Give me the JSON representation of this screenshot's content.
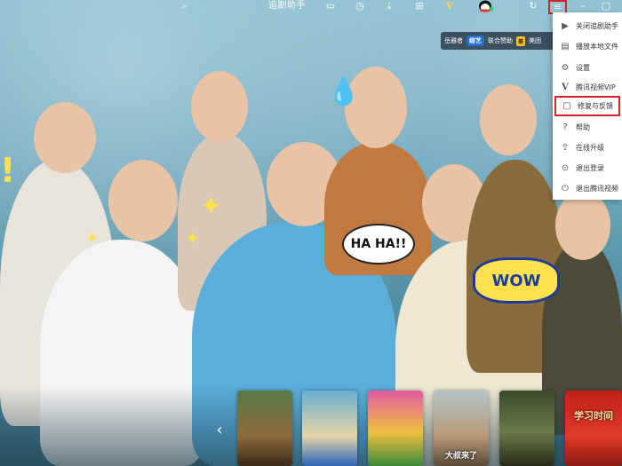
{
  "topbar": {
    "search_icon": "search-icon",
    "assistant_label": "追剧助手",
    "icons": [
      "play-screen-icon",
      "history-icon",
      "download-icon",
      "game-controller-icon",
      "vip-icon",
      "qq-avatar-icon",
      "refresh-icon",
      "menu-icon",
      "minimize-icon",
      "maximize-icon"
    ],
    "vip_glyph": "V"
  },
  "promo": {
    "text1": "岳雅者",
    "badge1": "综艺",
    "text2": "联合赞助",
    "badge2": "美",
    "text3": "美团"
  },
  "menu": {
    "items": [
      {
        "label": "关闭追剧助手",
        "icon": "play-circle-icon"
      },
      {
        "label": "播放本地文件",
        "icon": "folder-icon"
      },
      {
        "label": "设置",
        "icon": "gear-icon"
      },
      {
        "label": "腾讯视频VIP",
        "icon": "vip-v-icon"
      },
      {
        "label": "修复与反馈",
        "icon": "feedback-icon"
      },
      {
        "label": "帮助",
        "icon": "help-icon"
      },
      {
        "label": "在线升级",
        "icon": "upgrade-icon"
      },
      {
        "label": "退出登录",
        "icon": "logout-icon"
      },
      {
        "label": "退出腾讯视频",
        "icon": "power-icon"
      }
    ]
  },
  "stickers": {
    "haha": "HA HA!!",
    "wow": "WOW"
  },
  "thumbnails": [
    {
      "title": ""
    },
    {
      "title": ""
    },
    {
      "title": ""
    },
    {
      "title": "大叔来了"
    },
    {
      "title": ""
    },
    {
      "title": "学习时间"
    }
  ],
  "colors": {
    "highlight_red": "#d4232b",
    "vip_gold": "#ffd24d"
  }
}
